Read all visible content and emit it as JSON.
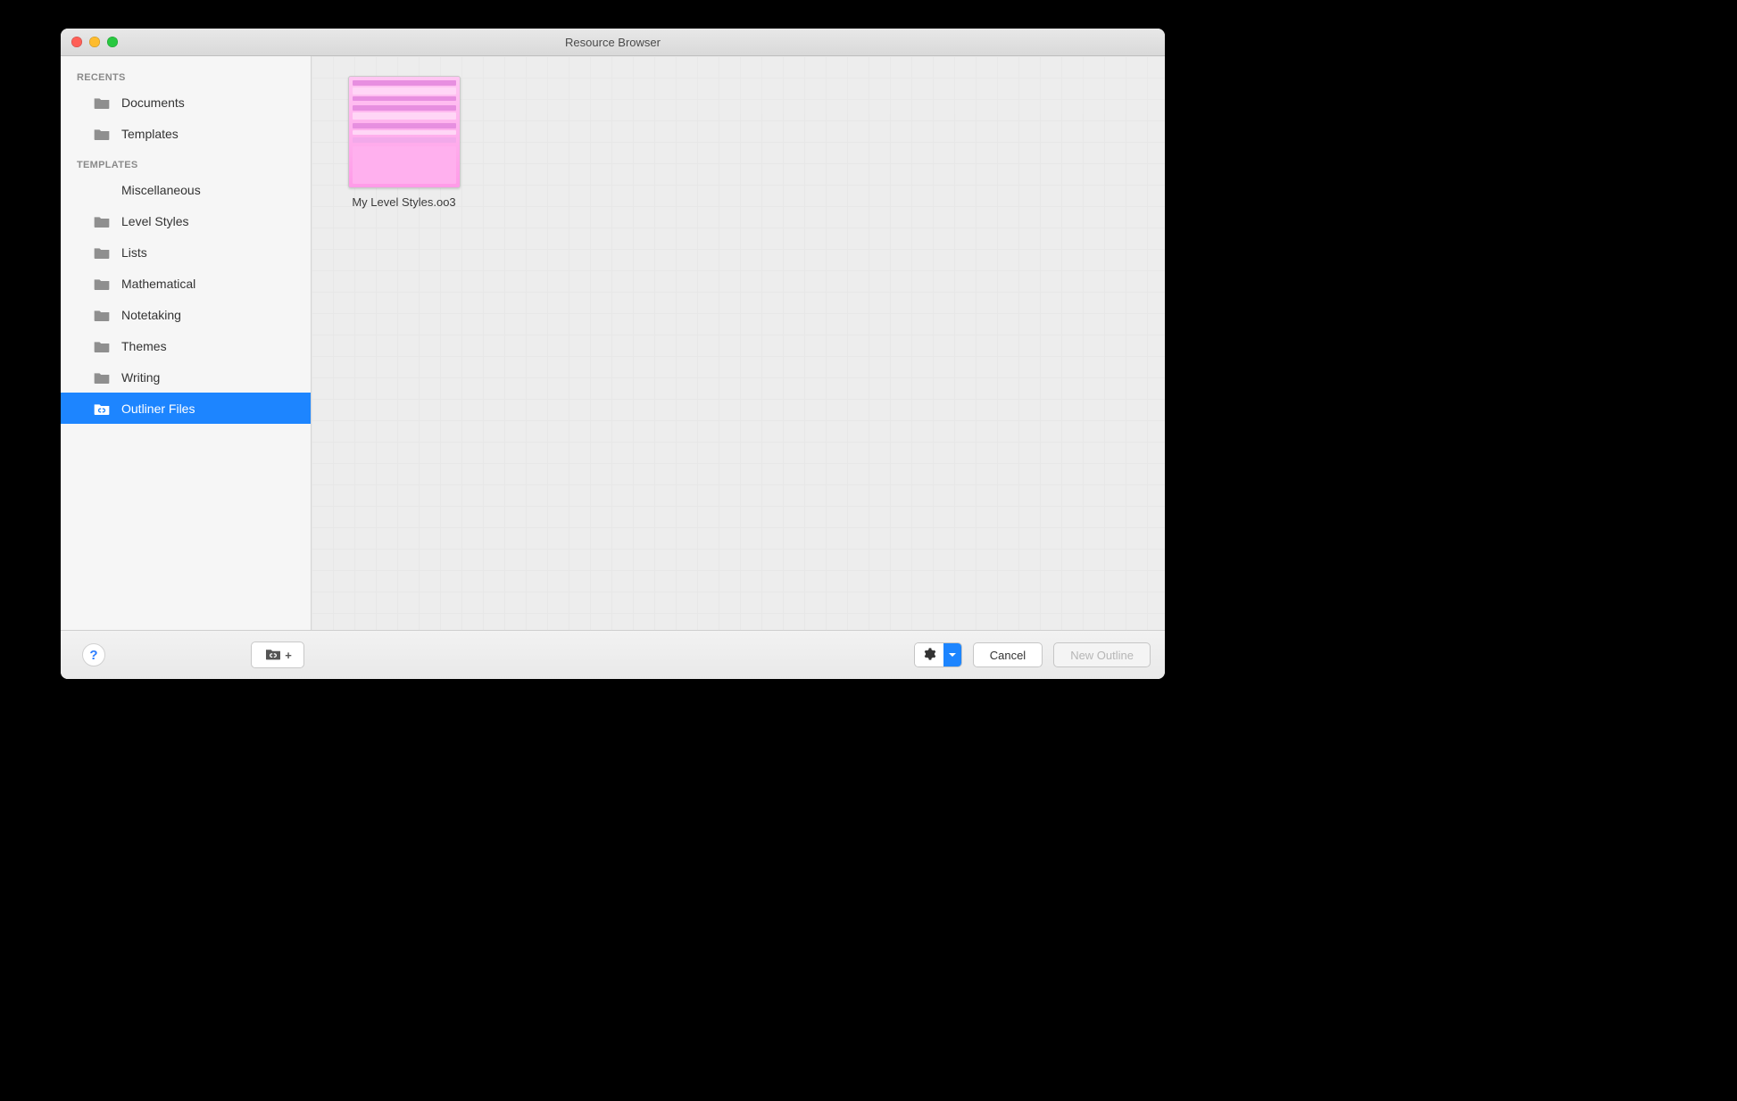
{
  "window": {
    "title": "Resource Browser"
  },
  "sidebar": {
    "sections": [
      {
        "header": "RECENTS",
        "items": [
          {
            "label": "Documents",
            "icon": "folder",
            "selected": false
          },
          {
            "label": "Templates",
            "icon": "folder",
            "selected": false
          }
        ]
      },
      {
        "header": "TEMPLATES",
        "items": [
          {
            "label": "Miscellaneous",
            "icon": "none",
            "selected": false
          },
          {
            "label": "Level Styles",
            "icon": "folder",
            "selected": false
          },
          {
            "label": "Lists",
            "icon": "folder",
            "selected": false
          },
          {
            "label": "Mathematical",
            "icon": "folder",
            "selected": false
          },
          {
            "label": "Notetaking",
            "icon": "folder",
            "selected": false
          },
          {
            "label": "Themes",
            "icon": "folder",
            "selected": false
          },
          {
            "label": "Writing",
            "icon": "folder",
            "selected": false
          },
          {
            "label": "Outliner Files",
            "icon": "link",
            "selected": true
          }
        ]
      }
    ]
  },
  "content": {
    "items": [
      {
        "filename": "My Level Styles.oo3"
      }
    ]
  },
  "footer": {
    "help_glyph": "?",
    "link_add_plus": "+",
    "cancel_label": "Cancel",
    "new_outline_label": "New Outline"
  }
}
